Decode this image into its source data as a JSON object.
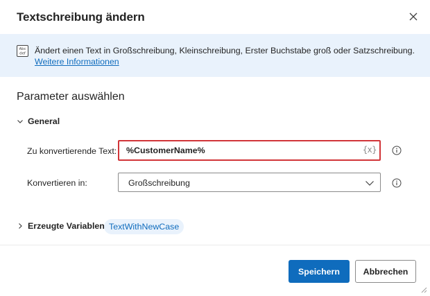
{
  "dialog": {
    "title": "Textschreibung ändern",
    "close_icon": "close-icon"
  },
  "info": {
    "icon": "abc-def-icon",
    "text": "Ändert einen Text in Großschreibung, Kleinschreibung, Erster Buchstabe groß oder Satzschreibung.",
    "link": "Weitere Informationen"
  },
  "parameters": {
    "title": "Parameter auswählen",
    "group_label": "General",
    "text_field": {
      "label": "Zu konvertierende Text:",
      "value": "%CustomerName%",
      "variable_button": "{x}",
      "state": "error"
    },
    "convert_field": {
      "label": "Konvertieren in:",
      "selected": "Großschreibung"
    }
  },
  "variables": {
    "label": "Erzeugte Variablen",
    "chip": "TextWithNewCase"
  },
  "footer": {
    "save_label": "Speichern",
    "cancel_label": "Abbrechen"
  },
  "colors": {
    "accent": "#0f6cbd",
    "info_background": "#e9f2fc",
    "error_border": "#d13438"
  }
}
